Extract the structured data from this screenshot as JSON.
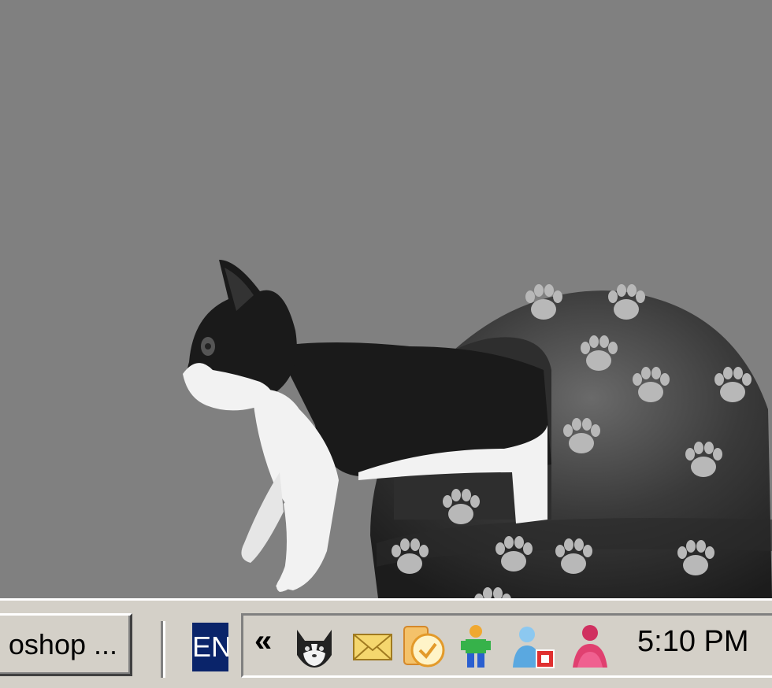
{
  "taskbar": {
    "task_button_label": "oshop ...",
    "language_indicator": "EN",
    "tray_expand_label": "«",
    "clock_time": "5:10 PM"
  },
  "tray_icons": [
    {
      "name": "cat-app-icon"
    },
    {
      "name": "mail-icon"
    },
    {
      "name": "outlook-reminder-icon"
    },
    {
      "name": "network-person-icon"
    },
    {
      "name": "messenger-offline-icon"
    },
    {
      "name": "msn-messenger-icon"
    }
  ],
  "colors": {
    "desktop_background": "#808080",
    "taskbar_background": "#d4d0c8",
    "language_background": "#0a246a"
  }
}
